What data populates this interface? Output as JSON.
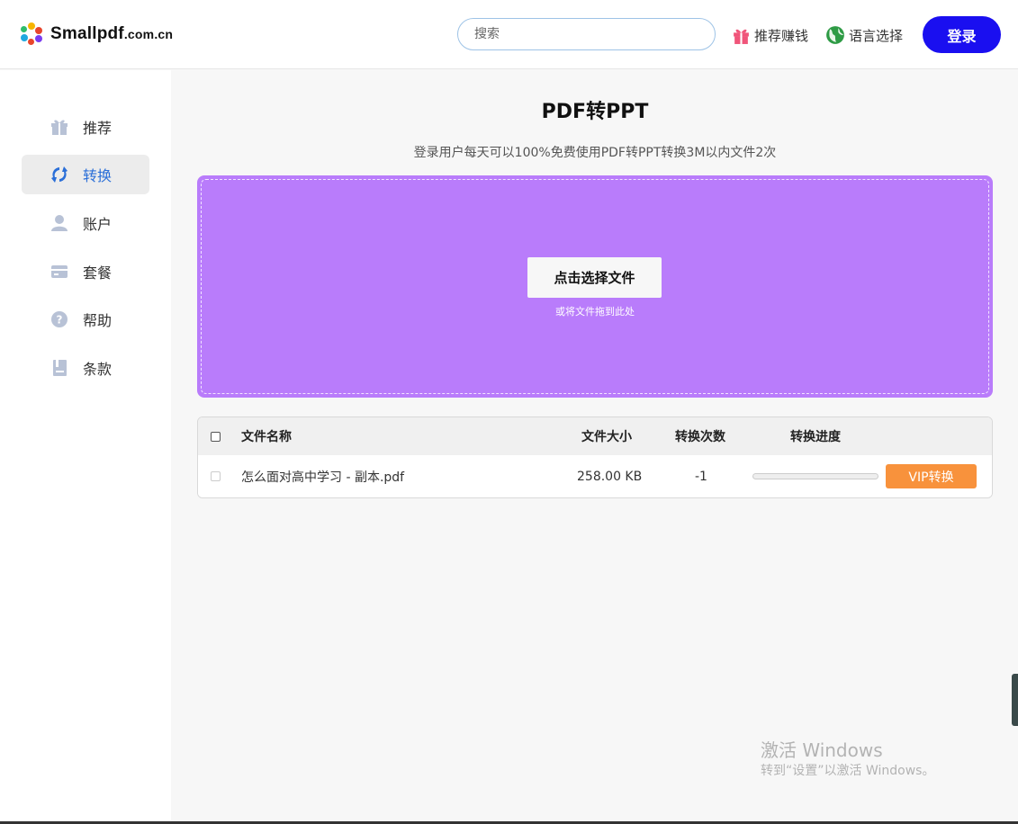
{
  "header": {
    "logo_text": "Smallpdf",
    "logo_suffix": ".com.cn",
    "search_placeholder": "搜索",
    "referral_label": "推荐赚钱",
    "language_label": "语言选择",
    "login_label": "登录"
  },
  "sidebar": {
    "items": [
      {
        "label": "推荐",
        "icon": "gift-icon"
      },
      {
        "label": "转换",
        "icon": "sync-icon",
        "active": true
      },
      {
        "label": "账户",
        "icon": "user-icon"
      },
      {
        "label": "套餐",
        "icon": "card-icon"
      },
      {
        "label": "帮助",
        "icon": "help-icon"
      },
      {
        "label": "条款",
        "icon": "document-icon"
      }
    ]
  },
  "main": {
    "title": "PDF转PPT",
    "subtitle": "登录用户每天可以100%免费使用PDF转PPT转换3M以内文件2次",
    "dropzone": {
      "button_label": "点击选择文件",
      "hint": "或将文件拖到此处"
    },
    "table": {
      "headers": {
        "name": "文件名称",
        "size": "文件大小",
        "count": "转换次数",
        "progress": "转换进度"
      },
      "rows": [
        {
          "name": "怎么面对高中学习 - 副本.pdf",
          "size": "258.00 KB",
          "count": "-1",
          "progress": 0,
          "action": "VIP转换"
        }
      ]
    }
  },
  "watermark": {
    "line1": "激活 Windows",
    "line2": "转到“设置”以激活 Windows。"
  },
  "colors": {
    "primary": "#1a0ff0",
    "dropzone": "#b97cfb",
    "vip": "#f8923c",
    "active_nav": "#2b6fd8"
  }
}
